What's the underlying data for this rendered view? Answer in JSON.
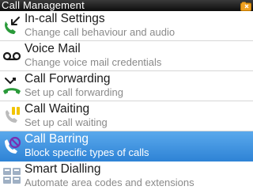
{
  "window": {
    "title": "Call Management"
  },
  "colors": {
    "selection": "#3a90dc",
    "subtext": "#8a8a8a",
    "titlebar": "#1a1a1a"
  },
  "menu": {
    "items": [
      {
        "label": "In-call Settings",
        "description": "Change call behaviour and audio",
        "icon": "handset-arrow-in-icon",
        "selected": false
      },
      {
        "label": "Voice Mail",
        "description": "Change voice mail credentials",
        "icon": "voicemail-icon",
        "selected": false
      },
      {
        "label": "Call Forwarding",
        "description": "Set up call forwarding",
        "icon": "call-forward-icon",
        "selected": false
      },
      {
        "label": "Call Waiting",
        "description": "Set up call waiting",
        "icon": "call-waiting-icon",
        "selected": false
      },
      {
        "label": "Call Barring",
        "description": "Block specific types of calls",
        "icon": "call-barring-icon",
        "selected": true
      },
      {
        "label": "Smart Dialling",
        "description": "Automate area codes and extensions",
        "icon": "keypad-icon",
        "selected": false
      }
    ]
  }
}
